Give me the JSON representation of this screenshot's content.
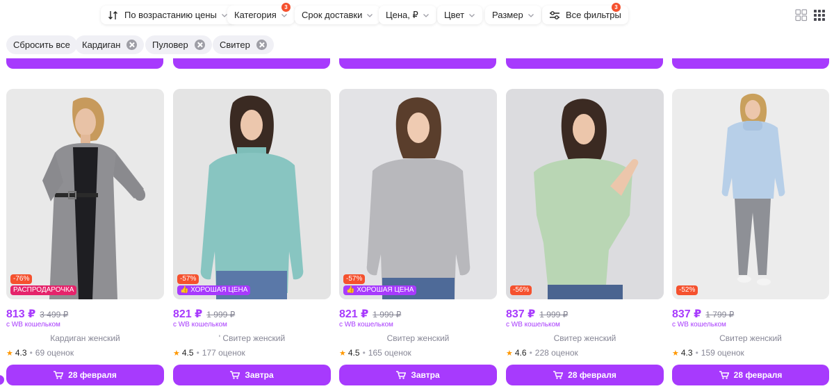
{
  "filters": {
    "sort": {
      "label": "По возрастанию цены",
      "icon": "sort-arrows-icon"
    },
    "category": {
      "label": "Категория",
      "badge": "3"
    },
    "delivery": {
      "label": "Срок доставки"
    },
    "price": {
      "label": "Цена, ₽"
    },
    "color": {
      "label": "Цвет"
    },
    "size": {
      "label": "Размер"
    },
    "all": {
      "label": "Все фильтры",
      "badge": "3",
      "icon": "sliders-icon"
    }
  },
  "chips": {
    "reset": "Сбросить все",
    "items": [
      "Кардиган",
      "Пуловер",
      "Свитер"
    ]
  },
  "colors": {
    "accent": "#a73afd",
    "discount": "#f5512e",
    "sale_tag": "#e5236b",
    "star": "#ff9800"
  },
  "products": [
    {
      "discount": "-76%",
      "tag": "РАСПРОДАРОЧКА",
      "tag_type": "sale",
      "price": "813 ₽",
      "old_price": "3 499 ₽",
      "wallet": "с WB кошельком",
      "name": "Кардиган женский",
      "rating": "4.3",
      "reviews": "69 оценок",
      "delivery": "28 февраля"
    },
    {
      "discount": "-57%",
      "tag": "ХОРОШАЯ ЦЕНА",
      "tag_type": "good",
      "price": "821 ₽",
      "old_price": "1 999 ₽",
      "wallet": "с WB кошельком",
      "name": "' Свитер женский",
      "rating": "4.5",
      "reviews": "177 оценок",
      "delivery": "Завтра"
    },
    {
      "discount": "-57%",
      "tag": "ХОРОШАЯ ЦЕНА",
      "tag_type": "good",
      "price": "821 ₽",
      "old_price": "1 999 ₽",
      "wallet": "с WB кошельком",
      "name": "Свитер женский",
      "rating": "4.5",
      "reviews": "165 оценок",
      "delivery": "Завтра"
    },
    {
      "discount": "-56%",
      "tag": "",
      "tag_type": "",
      "price": "837 ₽",
      "old_price": "1 999 ₽",
      "wallet": "с WB кошельком",
      "name": "Свитер женский",
      "rating": "4.6",
      "reviews": "228 оценок",
      "delivery": "28 февраля"
    },
    {
      "discount": "-52%",
      "tag": "",
      "tag_type": "",
      "price": "837 ₽",
      "old_price": "1 799 ₽",
      "wallet": "с WB кошельком",
      "name": "Свитер женский",
      "rating": "4.3",
      "reviews": "159 оценок",
      "delivery": "28 февраля"
    }
  ]
}
